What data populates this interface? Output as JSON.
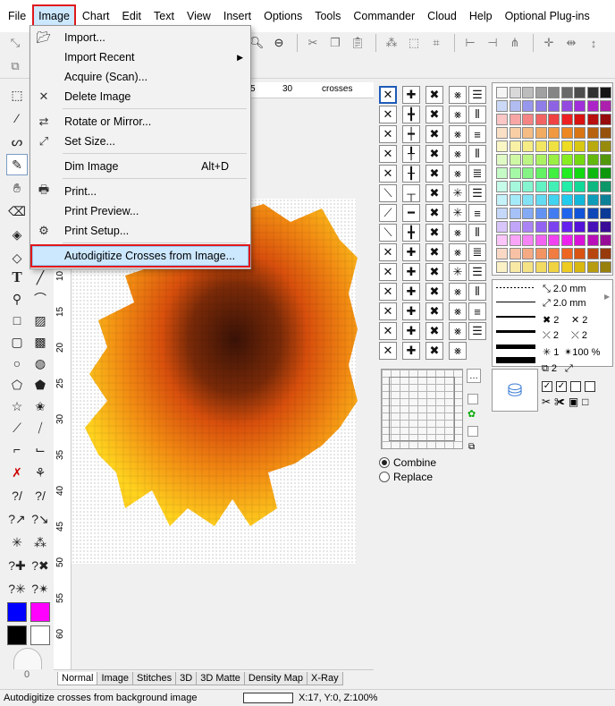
{
  "menubar": {
    "items": [
      "File",
      "Image",
      "Chart",
      "Edit",
      "Text",
      "View",
      "Insert",
      "Options",
      "Tools",
      "Commander",
      "Cloud",
      "Help",
      "Optional Plug-ins"
    ]
  },
  "image_menu": {
    "items": [
      {
        "label": "Import...",
        "icon": "import-icon"
      },
      {
        "label": "Import Recent",
        "icon": "",
        "submenu": true
      },
      {
        "label": "Acquire (Scan)...",
        "icon": ""
      },
      {
        "label": "Delete Image",
        "icon": "delete-x-icon"
      },
      {
        "label": "Rotate or Mirror...",
        "icon": "rotate-icon"
      },
      {
        "label": "Set Size...",
        "icon": "resize-icon"
      },
      {
        "label": "Dim Image",
        "icon": "",
        "shortcut": "Alt+D"
      },
      {
        "label": "Print...",
        "icon": "printer-icon"
      },
      {
        "label": "Print Preview...",
        "icon": ""
      },
      {
        "label": "Print Setup...",
        "icon": "print-setup-icon"
      },
      {
        "label": "Autodigitize Crosses from Image...",
        "icon": "",
        "highlighted": true
      }
    ]
  },
  "ruler": {
    "h_labels": [
      "5",
      "30",
      "crosses"
    ],
    "v_labels": [
      "10",
      "15",
      "20",
      "25",
      "30",
      "35",
      "40",
      "45",
      "50",
      "55",
      "60"
    ]
  },
  "bottom_tabs": [
    "Normal",
    "Image",
    "Stitches",
    "3D",
    "3D Matte",
    "Density Map",
    "X-Ray"
  ],
  "stitch_options": {
    "combine": "Combine",
    "replace": "Replace",
    "selected": "Combine"
  },
  "properties": {
    "width1": "2.0 mm",
    "width2": "2.0 mm",
    "count_a": "2",
    "count_b": "2",
    "count_c": "2",
    "count_d": "2",
    "count_e": "1",
    "zoom": "100 %",
    "count_f": "2"
  },
  "left_scale_value": "0",
  "colors": {
    "foreground": "#0000ff",
    "secondary": "#ff00ff",
    "black": "#000000",
    "white": "#ffffff",
    "accent_red": "#e0181c"
  },
  "status": {
    "message": "Autodigitize crosses from background image",
    "coords": "X:17, Y:0, Z:100%"
  }
}
